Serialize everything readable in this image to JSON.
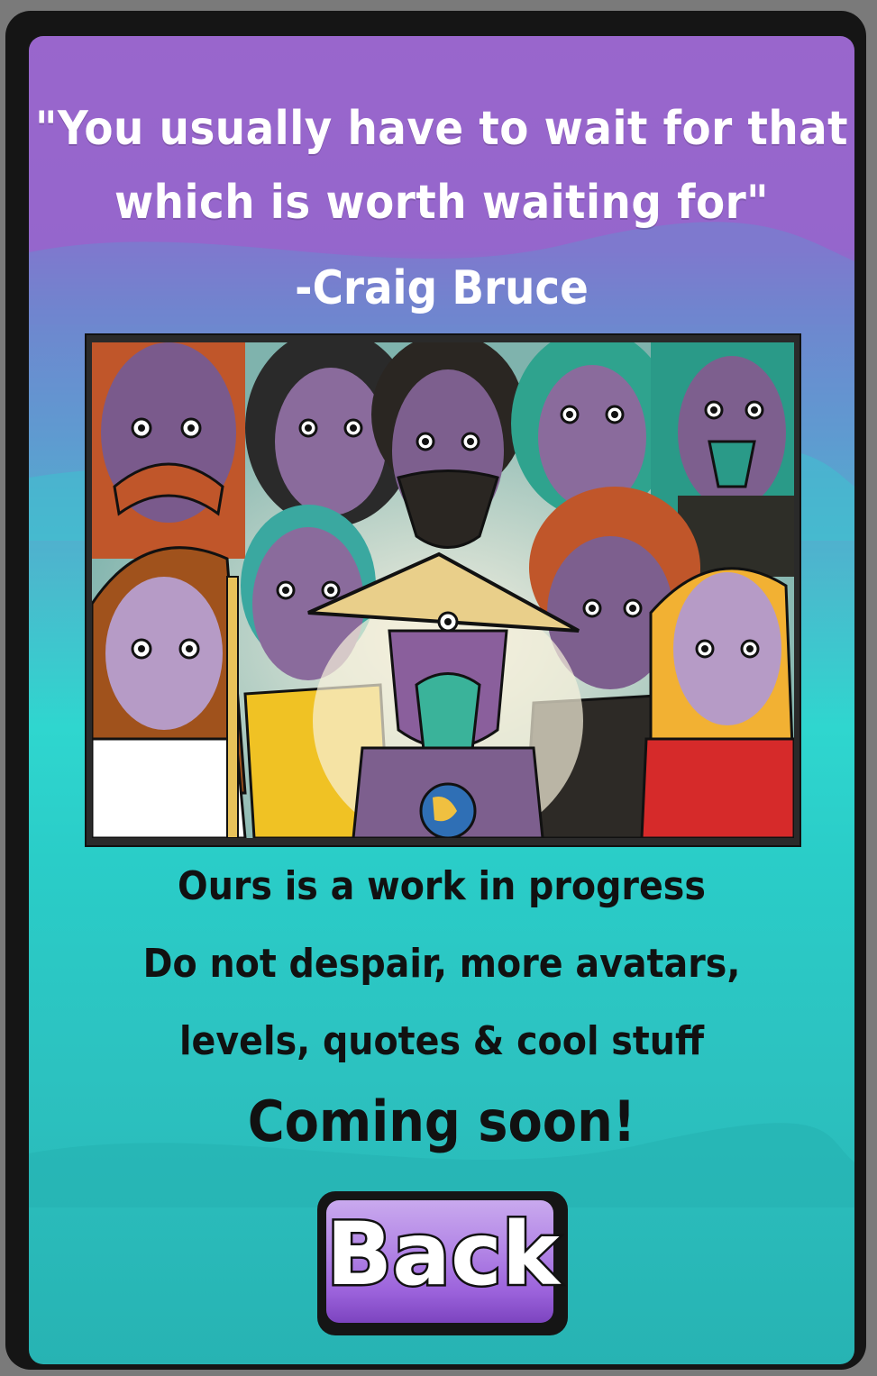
{
  "quote": {
    "line1": "\"You usually have to wait for that",
    "line2": "which is worth waiting for\"",
    "author": "-Craig Bruce"
  },
  "message": {
    "line1": "Ours is a work in progress",
    "line2": "Do not despair, more avatars,",
    "line3": "levels, quotes & cool stuff",
    "line4": "Coming soon!"
  },
  "back_button": {
    "label": "Back"
  },
  "colors": {
    "top_purple": "#9966cc",
    "mid_blue": "#5f9ad0",
    "bottom_teal": "#2acdc8",
    "button_purple": "#9b62db"
  }
}
